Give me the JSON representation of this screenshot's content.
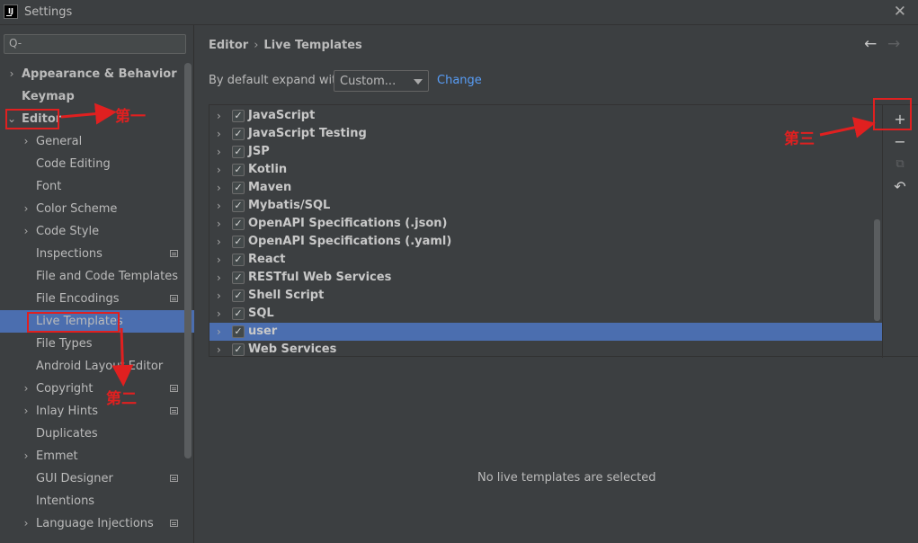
{
  "window": {
    "title": "Settings",
    "app_icon_text": "IJ"
  },
  "search": {
    "placeholder": "Q-"
  },
  "sidebar": {
    "items": [
      {
        "label": "Appearance & Behavior",
        "expanded": false,
        "bold": true
      },
      {
        "label": "Keymap",
        "bold": true
      },
      {
        "label": "Editor",
        "expanded": true,
        "bold": true
      },
      {
        "label": "General",
        "expandable": true
      },
      {
        "label": "Code Editing"
      },
      {
        "label": "Font"
      },
      {
        "label": "Color Scheme",
        "expandable": true
      },
      {
        "label": "Code Style",
        "expandable": true
      },
      {
        "label": "Inspections",
        "badge": true
      },
      {
        "label": "File and Code Templates"
      },
      {
        "label": "File Encodings",
        "badge": true
      },
      {
        "label": "Live Templates",
        "selected": true
      },
      {
        "label": "File Types"
      },
      {
        "label": "Android Layout Editor"
      },
      {
        "label": "Copyright",
        "expandable": true,
        "badge": true
      },
      {
        "label": "Inlay Hints",
        "expandable": true,
        "badge": true
      },
      {
        "label": "Duplicates"
      },
      {
        "label": "Emmet",
        "expandable": true
      },
      {
        "label": "GUI Designer",
        "badge": true
      },
      {
        "label": "Intentions"
      },
      {
        "label": "Language Injections",
        "expandable": true,
        "badge": true
      }
    ]
  },
  "breadcrumb": {
    "parent": "Editor",
    "separator": "›",
    "current": "Live Templates"
  },
  "nav": {
    "back": "←",
    "forward": "→"
  },
  "expand": {
    "label": "By default expand with",
    "value": "Custom...",
    "change_link": "Change"
  },
  "templates": [
    {
      "label": "JavaScript",
      "checked": true
    },
    {
      "label": "JavaScript Testing",
      "checked": true
    },
    {
      "label": "JSP",
      "checked": true
    },
    {
      "label": "Kotlin",
      "checked": true
    },
    {
      "label": "Maven",
      "checked": true
    },
    {
      "label": "Mybatis/SQL",
      "checked": true
    },
    {
      "label": "OpenAPI Specifications (.json)",
      "checked": true
    },
    {
      "label": "OpenAPI Specifications (.yaml)",
      "checked": true
    },
    {
      "label": "React",
      "checked": true
    },
    {
      "label": "RESTful Web Services",
      "checked": true
    },
    {
      "label": "Shell Script",
      "checked": true
    },
    {
      "label": "SQL",
      "checked": true
    },
    {
      "label": "user",
      "checked": true,
      "selected": true
    },
    {
      "label": "Web Services",
      "checked": true
    }
  ],
  "toolbar": {
    "add": "+",
    "remove": "−",
    "copy": "⧉",
    "restore": "↶"
  },
  "empty_message": "No live templates are selected",
  "annotations": {
    "first": "第一",
    "second": "第二",
    "third": "第三"
  },
  "colors": {
    "selection": "#4b6eaf",
    "link": "#589df6",
    "annotation": "#e02020",
    "background": "#3c3f41"
  }
}
